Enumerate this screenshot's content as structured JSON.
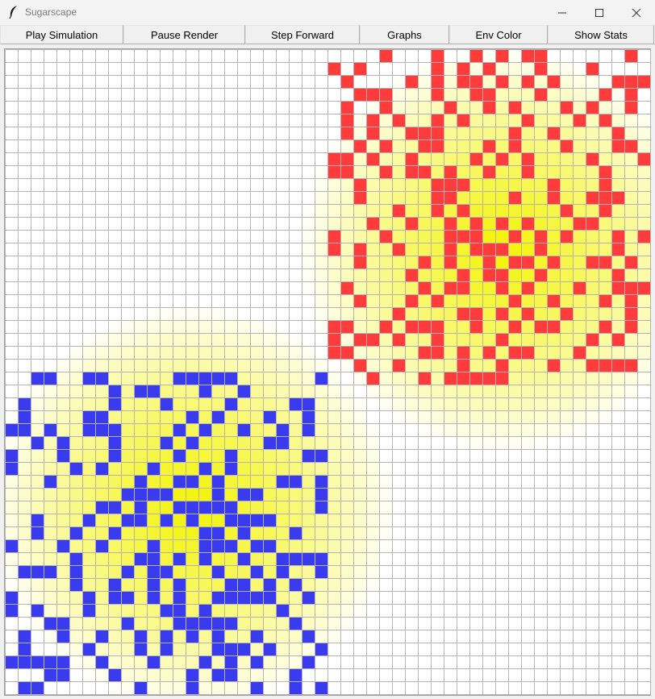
{
  "window": {
    "title": "Sugarscape",
    "accent": "#f3f3f3"
  },
  "window_controls": {
    "minimize_icon": "minimize-icon",
    "maximize_icon": "maximize-icon",
    "close_icon": "close-icon"
  },
  "toolbar": {
    "buttons": [
      {
        "label": "Play Simulation"
      },
      {
        "label": "Pause Render"
      },
      {
        "label": "Step Forward"
      },
      {
        "label": "Graphs"
      },
      {
        "label": "Env Color"
      },
      {
        "label": "Show Stats"
      }
    ]
  },
  "grid": {
    "cols": 50,
    "rows": 50,
    "colors": {
      "gridline": "#b4b4b4",
      "empty": "#ffffff",
      "agent_red": "#ff3b3b",
      "agent_blue": "#3a3aee",
      "sugar_max": "#f3f300"
    },
    "sugar_peaks": [
      {
        "col": 38,
        "row": 15
      },
      {
        "col": 14,
        "row": 35
      }
    ],
    "agents_red": [
      [
        0,
        29
      ],
      [
        0,
        33
      ],
      [
        0,
        36
      ],
      [
        0,
        38
      ],
      [
        0,
        40
      ],
      [
        0,
        41
      ],
      [
        0,
        48
      ],
      [
        1,
        25
      ],
      [
        1,
        27
      ],
      [
        1,
        33
      ],
      [
        1,
        35
      ],
      [
        1,
        37
      ],
      [
        1,
        41
      ],
      [
        1,
        45
      ],
      [
        2,
        26
      ],
      [
        2,
        31
      ],
      [
        2,
        33
      ],
      [
        2,
        35
      ],
      [
        2,
        36
      ],
      [
        2,
        38
      ],
      [
        2,
        40
      ],
      [
        2,
        42
      ],
      [
        2,
        47
      ],
      [
        2,
        48
      ],
      [
        2,
        49
      ],
      [
        3,
        27
      ],
      [
        3,
        28
      ],
      [
        3,
        29
      ],
      [
        3,
        33
      ],
      [
        3,
        36
      ],
      [
        3,
        37
      ],
      [
        3,
        41
      ],
      [
        3,
        46
      ],
      [
        3,
        48
      ],
      [
        4,
        26
      ],
      [
        4,
        29
      ],
      [
        4,
        34
      ],
      [
        4,
        37
      ],
      [
        4,
        39
      ],
      [
        4,
        43
      ],
      [
        4,
        45
      ],
      [
        4,
        48
      ],
      [
        5,
        26
      ],
      [
        5,
        28
      ],
      [
        5,
        30
      ],
      [
        5,
        33
      ],
      [
        5,
        35
      ],
      [
        5,
        40
      ],
      [
        5,
        44
      ],
      [
        5,
        46
      ],
      [
        6,
        26
      ],
      [
        6,
        28
      ],
      [
        6,
        31
      ],
      [
        6,
        32
      ],
      [
        6,
        33
      ],
      [
        6,
        39
      ],
      [
        6,
        42
      ],
      [
        6,
        47
      ],
      [
        7,
        27
      ],
      [
        7,
        29
      ],
      [
        7,
        32
      ],
      [
        7,
        33
      ],
      [
        7,
        37
      ],
      [
        7,
        39
      ],
      [
        7,
        43
      ],
      [
        7,
        47
      ],
      [
        7,
        48
      ],
      [
        8,
        25
      ],
      [
        8,
        26
      ],
      [
        8,
        28
      ],
      [
        8,
        31
      ],
      [
        8,
        36
      ],
      [
        8,
        38
      ],
      [
        8,
        40
      ],
      [
        8,
        45
      ],
      [
        8,
        49
      ],
      [
        9,
        25
      ],
      [
        9,
        26
      ],
      [
        9,
        29
      ],
      [
        9,
        31
      ],
      [
        9,
        32
      ],
      [
        9,
        34
      ],
      [
        9,
        37
      ],
      [
        9,
        40
      ],
      [
        9,
        46
      ],
      [
        10,
        27
      ],
      [
        10,
        33
      ],
      [
        10,
        34
      ],
      [
        10,
        35
      ],
      [
        10,
        42
      ],
      [
        10,
        46
      ],
      [
        11,
        27
      ],
      [
        11,
        33
      ],
      [
        11,
        34
      ],
      [
        11,
        39
      ],
      [
        11,
        42
      ],
      [
        11,
        45
      ],
      [
        11,
        46
      ],
      [
        11,
        47
      ],
      [
        12,
        30
      ],
      [
        12,
        33
      ],
      [
        12,
        35
      ],
      [
        12,
        43
      ],
      [
        12,
        46
      ],
      [
        13,
        28
      ],
      [
        13,
        31
      ],
      [
        13,
        34
      ],
      [
        13,
        36
      ],
      [
        13,
        38
      ],
      [
        13,
        40
      ],
      [
        13,
        44
      ],
      [
        13,
        45
      ],
      [
        14,
        25
      ],
      [
        14,
        29
      ],
      [
        14,
        34
      ],
      [
        14,
        35
      ],
      [
        14,
        36
      ],
      [
        14,
        39
      ],
      [
        14,
        41
      ],
      [
        14,
        43
      ],
      [
        14,
        47
      ],
      [
        14,
        49
      ],
      [
        15,
        25
      ],
      [
        15,
        27
      ],
      [
        15,
        30
      ],
      [
        15,
        34
      ],
      [
        15,
        36
      ],
      [
        15,
        37
      ],
      [
        15,
        38
      ],
      [
        15,
        41
      ],
      [
        15,
        47
      ],
      [
        16,
        27
      ],
      [
        16,
        32
      ],
      [
        16,
        34
      ],
      [
        16,
        37
      ],
      [
        16,
        39
      ],
      [
        16,
        40
      ],
      [
        16,
        42
      ],
      [
        16,
        45
      ],
      [
        16,
        46
      ],
      [
        16,
        48
      ],
      [
        17,
        31
      ],
      [
        17,
        35
      ],
      [
        17,
        37
      ],
      [
        17,
        38
      ],
      [
        17,
        41
      ],
      [
        17,
        47
      ],
      [
        18,
        26
      ],
      [
        18,
        32
      ],
      [
        18,
        34
      ],
      [
        18,
        35
      ],
      [
        18,
        38
      ],
      [
        18,
        40
      ],
      [
        18,
        44
      ],
      [
        18,
        47
      ],
      [
        18,
        48
      ],
      [
        18,
        49
      ],
      [
        19,
        27
      ],
      [
        19,
        31
      ],
      [
        19,
        33
      ],
      [
        19,
        39
      ],
      [
        19,
        42
      ],
      [
        19,
        46
      ],
      [
        19,
        48
      ],
      [
        20,
        30
      ],
      [
        20,
        35
      ],
      [
        20,
        36
      ],
      [
        20,
        38
      ],
      [
        20,
        40
      ],
      [
        20,
        43
      ],
      [
        20,
        48
      ],
      [
        21,
        25
      ],
      [
        21,
        26
      ],
      [
        21,
        29
      ],
      [
        21,
        31
      ],
      [
        21,
        32
      ],
      [
        21,
        33
      ],
      [
        21,
        36
      ],
      [
        21,
        39
      ],
      [
        21,
        41
      ],
      [
        21,
        42
      ],
      [
        21,
        46
      ],
      [
        21,
        48
      ],
      [
        22,
        25
      ],
      [
        22,
        27
      ],
      [
        22,
        28
      ],
      [
        22,
        30
      ],
      [
        22,
        33
      ],
      [
        22,
        38
      ],
      [
        22,
        45
      ],
      [
        22,
        47
      ],
      [
        23,
        25
      ],
      [
        23,
        26
      ],
      [
        23,
        32
      ],
      [
        23,
        33
      ],
      [
        23,
        35
      ],
      [
        23,
        37
      ],
      [
        23,
        39
      ],
      [
        23,
        40
      ],
      [
        23,
        44
      ],
      [
        24,
        27
      ],
      [
        24,
        30
      ],
      [
        24,
        35
      ],
      [
        24,
        38
      ],
      [
        24,
        42
      ],
      [
        24,
        45
      ],
      [
        24,
        46
      ],
      [
        24,
        47
      ],
      [
        24,
        48
      ],
      [
        25,
        28
      ],
      [
        25,
        32
      ],
      [
        25,
        34
      ],
      [
        25,
        35
      ],
      [
        25,
        36
      ],
      [
        25,
        37
      ],
      [
        25,
        38
      ]
    ],
    "agents_blue": [
      [
        25,
        2
      ],
      [
        25,
        3
      ],
      [
        25,
        6
      ],
      [
        25,
        7
      ],
      [
        25,
        13
      ],
      [
        25,
        14
      ],
      [
        25,
        15
      ],
      [
        25,
        16
      ],
      [
        25,
        17
      ],
      [
        25,
        24
      ],
      [
        26,
        8
      ],
      [
        26,
        10
      ],
      [
        26,
        11
      ],
      [
        26,
        15
      ],
      [
        26,
        18
      ],
      [
        27,
        1
      ],
      [
        27,
        8
      ],
      [
        27,
        12
      ],
      [
        27,
        17
      ],
      [
        27,
        22
      ],
      [
        27,
        23
      ],
      [
        28,
        1
      ],
      [
        28,
        6
      ],
      [
        28,
        7
      ],
      [
        28,
        14
      ],
      [
        28,
        16
      ],
      [
        28,
        20
      ],
      [
        28,
        23
      ],
      [
        29,
        0
      ],
      [
        29,
        1
      ],
      [
        29,
        3
      ],
      [
        29,
        6
      ],
      [
        29,
        7
      ],
      [
        29,
        8
      ],
      [
        29,
        13
      ],
      [
        29,
        15
      ],
      [
        29,
        18
      ],
      [
        29,
        21
      ],
      [
        29,
        23
      ],
      [
        30,
        2
      ],
      [
        30,
        4
      ],
      [
        30,
        8
      ],
      [
        30,
        12
      ],
      [
        30,
        14
      ],
      [
        30,
        20
      ],
      [
        30,
        21
      ],
      [
        31,
        0
      ],
      [
        31,
        4
      ],
      [
        31,
        8
      ],
      [
        31,
        13
      ],
      [
        31,
        17
      ],
      [
        31,
        23
      ],
      [
        31,
        24
      ],
      [
        32,
        0
      ],
      [
        32,
        5
      ],
      [
        32,
        7
      ],
      [
        32,
        11
      ],
      [
        32,
        15
      ],
      [
        32,
        17
      ],
      [
        33,
        3
      ],
      [
        33,
        10
      ],
      [
        33,
        13
      ],
      [
        33,
        14
      ],
      [
        33,
        16
      ],
      [
        33,
        21
      ],
      [
        33,
        22
      ],
      [
        33,
        24
      ],
      [
        34,
        9
      ],
      [
        34,
        10
      ],
      [
        34,
        11
      ],
      [
        34,
        12
      ],
      [
        34,
        16
      ],
      [
        34,
        18
      ],
      [
        34,
        19
      ],
      [
        34,
        24
      ],
      [
        35,
        7
      ],
      [
        35,
        8
      ],
      [
        35,
        10
      ],
      [
        35,
        13
      ],
      [
        35,
        14
      ],
      [
        35,
        15
      ],
      [
        35,
        16
      ],
      [
        35,
        17
      ],
      [
        35,
        24
      ],
      [
        36,
        2
      ],
      [
        36,
        6
      ],
      [
        36,
        9
      ],
      [
        36,
        10
      ],
      [
        36,
        12
      ],
      [
        36,
        14
      ],
      [
        36,
        17
      ],
      [
        36,
        18
      ],
      [
        36,
        19
      ],
      [
        36,
        20
      ],
      [
        37,
        2
      ],
      [
        37,
        5
      ],
      [
        37,
        8
      ],
      [
        37,
        15
      ],
      [
        37,
        16
      ],
      [
        37,
        18
      ],
      [
        37,
        22
      ],
      [
        38,
        0
      ],
      [
        38,
        4
      ],
      [
        38,
        7
      ],
      [
        38,
        11
      ],
      [
        38,
        15
      ],
      [
        38,
        16
      ],
      [
        38,
        17
      ],
      [
        38,
        19
      ],
      [
        38,
        20
      ],
      [
        39,
        5
      ],
      [
        39,
        10
      ],
      [
        39,
        11
      ],
      [
        39,
        13
      ],
      [
        39,
        15
      ],
      [
        39,
        18
      ],
      [
        39,
        21
      ],
      [
        39,
        22
      ],
      [
        39,
        23
      ],
      [
        39,
        24
      ],
      [
        40,
        1
      ],
      [
        40,
        2
      ],
      [
        40,
        3
      ],
      [
        40,
        5
      ],
      [
        40,
        9
      ],
      [
        40,
        11
      ],
      [
        40,
        12
      ],
      [
        40,
        16
      ],
      [
        40,
        19
      ],
      [
        40,
        21
      ],
      [
        40,
        24
      ],
      [
        41,
        5
      ],
      [
        41,
        8
      ],
      [
        41,
        11
      ],
      [
        41,
        13
      ],
      [
        41,
        17
      ],
      [
        41,
        18
      ],
      [
        41,
        20
      ],
      [
        41,
        22
      ],
      [
        42,
        0
      ],
      [
        42,
        6
      ],
      [
        42,
        8
      ],
      [
        42,
        9
      ],
      [
        42,
        11
      ],
      [
        42,
        13
      ],
      [
        42,
        16
      ],
      [
        42,
        17
      ],
      [
        42,
        18
      ],
      [
        42,
        19
      ],
      [
        42,
        20
      ],
      [
        42,
        23
      ],
      [
        43,
        0
      ],
      [
        43,
        2
      ],
      [
        43,
        6
      ],
      [
        43,
        12
      ],
      [
        43,
        13
      ],
      [
        43,
        15
      ],
      [
        43,
        21
      ],
      [
        44,
        3
      ],
      [
        44,
        4
      ],
      [
        44,
        9
      ],
      [
        44,
        13
      ],
      [
        44,
        14
      ],
      [
        44,
        15
      ],
      [
        44,
        16
      ],
      [
        44,
        17
      ],
      [
        44,
        22
      ],
      [
        45,
        1
      ],
      [
        45,
        4
      ],
      [
        45,
        7
      ],
      [
        45,
        10
      ],
      [
        45,
        12
      ],
      [
        45,
        14
      ],
      [
        45,
        16
      ],
      [
        45,
        19
      ],
      [
        45,
        23
      ],
      [
        46,
        1
      ],
      [
        46,
        6
      ],
      [
        46,
        10
      ],
      [
        46,
        12
      ],
      [
        46,
        16
      ],
      [
        46,
        17
      ],
      [
        46,
        18
      ],
      [
        46,
        20
      ],
      [
        46,
        24
      ],
      [
        47,
        0
      ],
      [
        47,
        1
      ],
      [
        47,
        2
      ],
      [
        47,
        3
      ],
      [
        47,
        4
      ],
      [
        47,
        7
      ],
      [
        47,
        11
      ],
      [
        47,
        15
      ],
      [
        47,
        17
      ],
      [
        47,
        19
      ],
      [
        47,
        23
      ],
      [
        48,
        3
      ],
      [
        48,
        4
      ],
      [
        48,
        8
      ],
      [
        48,
        14
      ],
      [
        48,
        16
      ],
      [
        48,
        17
      ],
      [
        48,
        22
      ],
      [
        49,
        1
      ],
      [
        49,
        2
      ],
      [
        49,
        10
      ],
      [
        49,
        14
      ],
      [
        49,
        19
      ],
      [
        49,
        22
      ],
      [
        49,
        24
      ]
    ]
  }
}
